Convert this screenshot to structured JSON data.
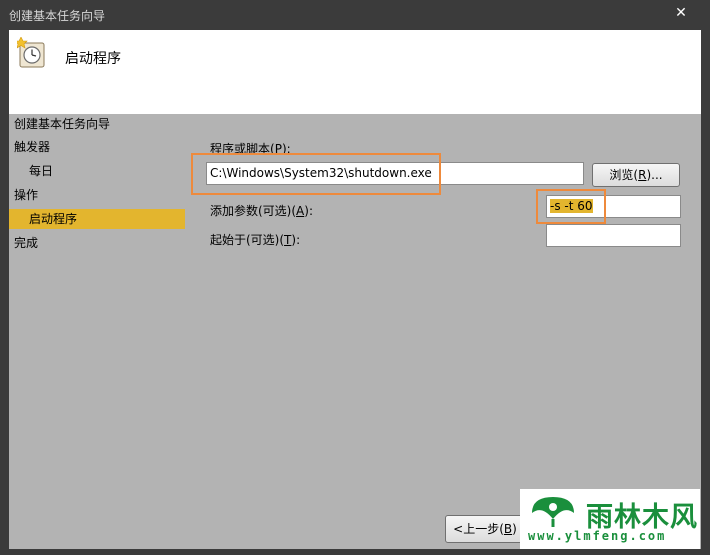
{
  "window": {
    "title": "创建基本任务向导",
    "close_glyph": "✕"
  },
  "header": {
    "title": "启动程序",
    "icon": "clock-task-icon"
  },
  "nav": {
    "items": [
      {
        "label": "创建基本任务向导"
      },
      {
        "label": "触发器"
      },
      {
        "label": "每日"
      },
      {
        "label": "操作"
      },
      {
        "label": "启动程序"
      },
      {
        "label": "完成"
      }
    ],
    "selected_index": 4
  },
  "form": {
    "program_label_pre": "程序或脚本(",
    "program_label_key": "P",
    "program_label_post": "):",
    "program_value": "C:\\Windows\\System32\\shutdown.exe",
    "browse_pre": "浏览(",
    "browse_key": "R",
    "browse_post": ")...",
    "args_label_pre": "添加参数(可选)(",
    "args_label_key": "A",
    "args_label_post": "):",
    "args_value": "-s -t 60",
    "start_label_pre": "起始于(可选)(",
    "start_label_key": "T",
    "start_label_post": "):",
    "start_value": ""
  },
  "footer": {
    "back_pre": "<上一步(",
    "back_key": "B",
    "back_post": ")"
  },
  "watermark": {
    "name": "雨林木风",
    "url": "www.ylmfeng.com"
  },
  "colors": {
    "highlight": "#e3b52e",
    "annotation": "#ee8a3c",
    "watermark": "#1a8f3c"
  }
}
